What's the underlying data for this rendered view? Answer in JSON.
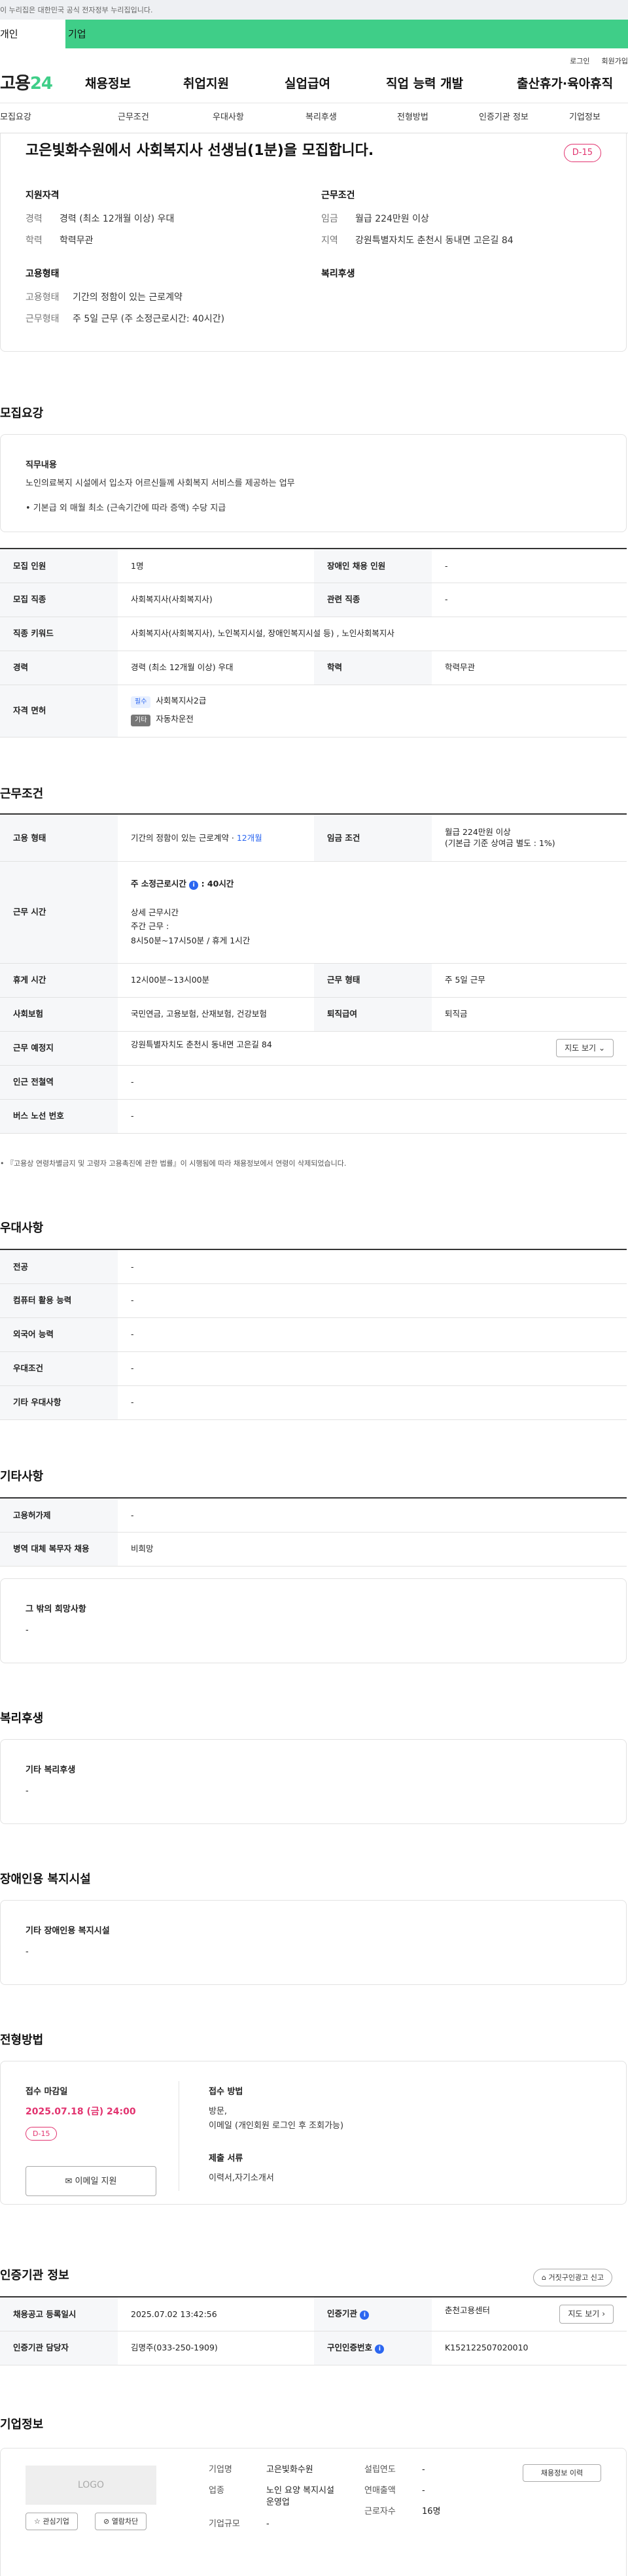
{
  "gov_banner": "이 누리집은 대한민국 공식 전자정부 누리집입니다.",
  "user_tabs": [
    "개인",
    "기업"
  ],
  "util": [
    "로그인",
    "회원가입"
  ],
  "logo_pre": "고용",
  "logo_num": "24",
  "gnb": [
    "채용정보",
    "취업지원",
    "실업급여",
    "직업 능력 개발",
    "출산휴가·육아휴직"
  ],
  "snb": [
    "모집요강",
    "근무조건",
    "우대사항",
    "복리후생",
    "전형방법",
    "인증기관 정보",
    "기업정보"
  ],
  "title": "고은빛화수원에서 사회복지사 선생님(1분)을 모집합니다.",
  "dday": "D-15",
  "summary": {
    "left_title": "지원자격",
    "left": [
      {
        "k": "경력",
        "v": "경력 (최소 12개월 이상) 우대"
      },
      {
        "k": "학력",
        "v": "학력무관"
      }
    ],
    "right_title": "근무조건",
    "right": [
      {
        "k": "임금",
        "v": "월급 224만원 이상"
      },
      {
        "k": "지역",
        "v": "강원특별자치도 춘천시 동내면 고은길 84"
      }
    ],
    "type_title": "고용형태",
    "type": [
      {
        "k": "고용형태",
        "v": "기간의 정함이 있는 근로계약"
      },
      {
        "k": "근무형태",
        "v": "주 5일 근무 (주 소정근로시간: 40시간)"
      }
    ],
    "welfare_title": "복리후생"
  },
  "recruit": {
    "heading": "모집요강",
    "duty_title": "직무내용",
    "duty_lines": [
      "노인의료복지 시설에서 입소자 어르신들께 사회복지 서비스를 제공하는 업무",
      "• 기본급 외 매월 최소 (근속기간에 따라 증액) 수당 지급"
    ],
    "rows": {
      "r1": {
        "k1": "모집 인원",
        "v1": "1명",
        "k2": "장애인 채용 인원",
        "v2": "-"
      },
      "r2": {
        "k1": "모집 직종",
        "v1": "사회복지사(사회복지사)",
        "k2": "관련 직종",
        "v2": "-"
      },
      "r3": {
        "k": "직종 키워드",
        "v": "사회복지사(사회복지사), 노인복지시설, 장애인복지시설 등) , 노인사회복지사"
      },
      "r4": {
        "k1": "경력",
        "v1": "경력 (최소 12개월 이상) 우대",
        "k2": "학력",
        "v2": "학력무관"
      },
      "r5": {
        "k": "자격 면허",
        "tag1": "필수",
        "l1": "사회복지사2급",
        "tag2": "기타",
        "l2": "자동차운전"
      }
    }
  },
  "cond": {
    "heading": "근무조건",
    "r1": {
      "k1": "고용 형태",
      "v1": "기간의 정함이 있는 근로계약 · ",
      "v1b": "12개월",
      "k2": "임금 조건",
      "v2": "월급 224만원 이상",
      "v2b": "(기본급 기준 상여금 별도 : 1%)"
    },
    "r2": {
      "k": "근무 시간",
      "l1": "주 소정근로시간",
      "l1b": ": 40시간",
      "l2": "상세 근무시간",
      "l3": "주간 근무 :",
      "l4": "8시50분~17시50분 / 휴게 1시간"
    },
    "r3": {
      "k1": "휴게 시간",
      "v1": "12시00분~13시00분",
      "k2": "근무 형태",
      "v2": "주 5일 근무"
    },
    "r4": {
      "k1": "사회보험",
      "v1": "국민연금, 고용보험, 산재보험, 건강보험",
      "k2": "퇴직급여",
      "v2": "퇴직금"
    },
    "r5": {
      "k": "근무 예정지",
      "v": "강원특별자치도 춘천시 동내면 고은길 84",
      "btn": "지도 보기"
    },
    "r6": {
      "k": "인근 전철역",
      "v": "-"
    },
    "r7": {
      "k": "버스 노선 번호",
      "v": "-"
    },
    "note": "『고용상 연령차별금지 및 고령자 고용촉진에 관한 법률』이 시행됨에 따라 채용정보에서 연령이 삭제되었습니다."
  },
  "pref": {
    "heading": "우대사항",
    "rows": [
      {
        "k": "전공",
        "v": "-"
      },
      {
        "k": "컴퓨터 활용 능력",
        "v": "-"
      },
      {
        "k": "외국어 능력",
        "v": "-"
      },
      {
        "k": "우대조건",
        "v": "-"
      },
      {
        "k": "기타 우대사항",
        "v": "-"
      }
    ]
  },
  "etc": {
    "heading": "기타사항",
    "rows": [
      {
        "k": "고용허가제",
        "v": "-"
      },
      {
        "k": "병역 대체 복무자 채용",
        "v": "비희망"
      }
    ],
    "box_title": "그 밖의 희망사항",
    "box_value": "-"
  },
  "welfare": {
    "heading": "복리후생",
    "box_title": "기타 복리후생",
    "box_value": "-"
  },
  "facility": {
    "heading": "장애인용 복지시설",
    "box_title": "기타 장애인용 복지시설",
    "box_value": "-"
  },
  "select": {
    "heading": "전형방법",
    "deadline_title": "접수 마감일",
    "deadline": "2025.07.18 (금) 24:00",
    "dday": "D-15",
    "apply_btn": "이메일 지원",
    "method_title": "접수 방법",
    "method_v": "방문,",
    "method_v2": "이메일 (개인회원 로그인 후 조회가능)",
    "docs_title": "제출 서류",
    "docs_v": "이력서,자기소개서"
  },
  "agency": {
    "heading": "인증기관 정보",
    "report_btn": "거짓구인광고 신고",
    "r1": {
      "k1": "채용공고 등록일시",
      "v1": "2025.07.02 13:42:56",
      "k2": "인증기관",
      "v2": "춘천고용센터",
      "btn": "지도 보기"
    },
    "r2": {
      "k1": "인증기관 담당자",
      "v1": "김명주(033-250-1909)",
      "k2": "구인인증번호",
      "v2": "K152122507020010"
    }
  },
  "company": {
    "heading": "기업정보",
    "logo": "LOGO",
    "fav_btn": "관심기업",
    "block_btn": "열람차단",
    "info": [
      {
        "k": "기업명",
        "v": "고은빛화수원"
      },
      {
        "k": "업종",
        "v": "노인 요양 복지시설 운영업"
      },
      {
        "k": "기업규모",
        "v": "-"
      }
    ],
    "info2": [
      {
        "k": "설립연도",
        "v": "-"
      },
      {
        "k": "연매출액",
        "v": "-"
      },
      {
        "k": "근로자수",
        "v": "16명"
      }
    ],
    "jobs_btn": "채용정보 이력"
  },
  "colors": {
    "brand": "#3fce88",
    "accent": "#e2336f",
    "link": "#2b66f0"
  }
}
